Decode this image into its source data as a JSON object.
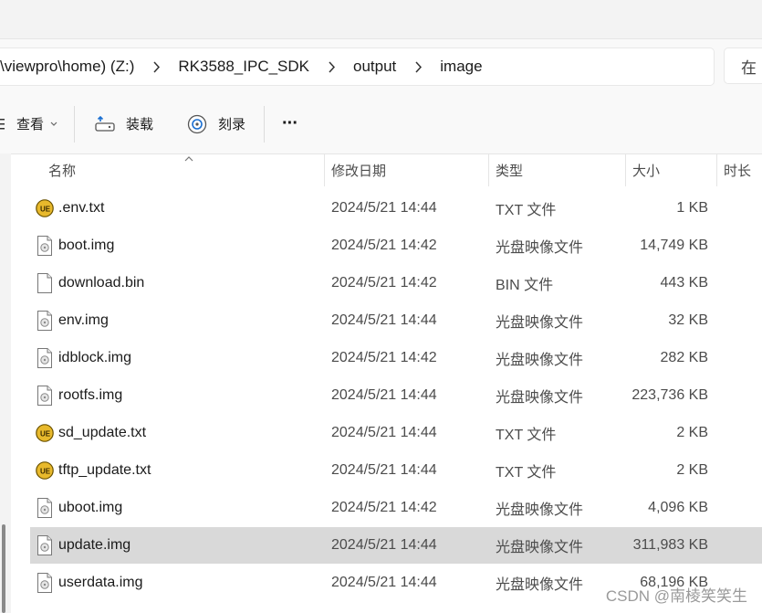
{
  "address": {
    "crumbs": [
      "\\viewpro\\home) (Z:)",
      "RK3588_IPC_SDK",
      "output",
      "image"
    ],
    "search_placeholder": "在"
  },
  "toolbar": {
    "view_label": "查看",
    "mount_label": "装载",
    "burn_label": "刻录",
    "more_label": "···"
  },
  "columns": {
    "name": "名称",
    "date": "修改日期",
    "type": "类型",
    "size": "大小",
    "duration": "时长"
  },
  "files": [
    {
      "name": ".env.txt",
      "date": "2024/5/21 14:44",
      "type": "TXT 文件",
      "size": "1 KB",
      "icon": "ue-text-icon"
    },
    {
      "name": "boot.img",
      "date": "2024/5/21 14:42",
      "type": "光盘映像文件",
      "size": "14,749 KB",
      "icon": "disc-image-file-icon"
    },
    {
      "name": "download.bin",
      "date": "2024/5/21 14:42",
      "type": "BIN 文件",
      "size": "443 KB",
      "icon": "blank-file-icon"
    },
    {
      "name": "env.img",
      "date": "2024/5/21 14:44",
      "type": "光盘映像文件",
      "size": "32 KB",
      "icon": "disc-image-file-icon"
    },
    {
      "name": "idblock.img",
      "date": "2024/5/21 14:42",
      "type": "光盘映像文件",
      "size": "282 KB",
      "icon": "disc-image-file-icon"
    },
    {
      "name": "rootfs.img",
      "date": "2024/5/21 14:44",
      "type": "光盘映像文件",
      "size": "223,736 KB",
      "icon": "disc-image-file-icon"
    },
    {
      "name": "sd_update.txt",
      "date": "2024/5/21 14:44",
      "type": "TXT 文件",
      "size": "2 KB",
      "icon": "ue-text-icon"
    },
    {
      "name": "tftp_update.txt",
      "date": "2024/5/21 14:44",
      "type": "TXT 文件",
      "size": "2 KB",
      "icon": "ue-text-icon"
    },
    {
      "name": "uboot.img",
      "date": "2024/5/21 14:42",
      "type": "光盘映像文件",
      "size": "4,096 KB",
      "icon": "disc-image-file-icon"
    },
    {
      "name": "update.img",
      "date": "2024/5/21 14:44",
      "type": "光盘映像文件",
      "size": "311,983 KB",
      "icon": "disc-image-file-icon",
      "selected": true
    },
    {
      "name": "userdata.img",
      "date": "2024/5/21 14:44",
      "type": "光盘映像文件",
      "size": "68,196 KB",
      "icon": "disc-image-file-icon"
    }
  ],
  "watermark": "CSDN @南棱笑笑生",
  "colors": {
    "selected_row": "#d9d9d9",
    "ue_icon_fill": "#e8b92c"
  }
}
